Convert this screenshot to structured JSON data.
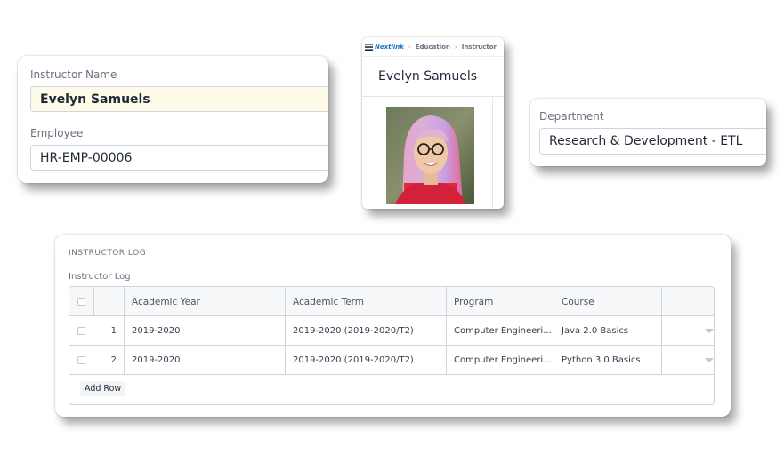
{
  "instructor_card": {
    "name_label": "Instructor Name",
    "name_value": "Evelyn Samuels",
    "employee_label": "Employee",
    "employee_value": "HR-EMP-00006"
  },
  "profile_card": {
    "logo_text": "Nextlink",
    "breadcrumb": [
      "Education",
      "Instructor"
    ],
    "name": "Evelyn Samuels"
  },
  "department_card": {
    "label": "Department",
    "value": "Research & Development - ETL"
  },
  "instructor_log": {
    "section_title": "INSTRUCTOR LOG",
    "table_label": "Instructor Log",
    "columns": [
      "Academic Year",
      "Academic Term",
      "Program",
      "Course"
    ],
    "rows": [
      {
        "idx": "1",
        "academic_year": "2019-2020",
        "academic_term": "2019-2020 (2019-2020/T2)",
        "program": "Computer Engineeri...",
        "course": "Java 2.0 Basics"
      },
      {
        "idx": "2",
        "academic_year": "2019-2020",
        "academic_term": "2019-2020 (2019-2020/T2)",
        "program": "Computer Engineeri...",
        "course": "Python 3.0 Basics"
      }
    ],
    "add_row_label": "Add Row"
  },
  "colors": {
    "name_field_bg": "#fefce8",
    "logo_blue": "#1e73be"
  }
}
